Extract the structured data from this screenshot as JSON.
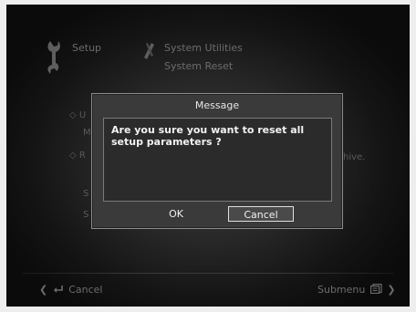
{
  "header": {
    "setup_label": "Setup",
    "utilities_label": "System Utilities",
    "subtitle": "System Reset"
  },
  "background_items": {
    "item1_frag": "U",
    "item1_line2_frag": "M",
    "item2_frag": "R",
    "item2_tail": "hive.",
    "item3_frag": "S",
    "item4_frag": "S"
  },
  "dialog": {
    "title": "Message",
    "message": "Are you sure you want to reset all setup parameters ?",
    "ok_label": "OK",
    "cancel_label": "Cancel",
    "selected": "Cancel"
  },
  "footer": {
    "back_label": "Cancel",
    "submenu_label": "Submenu"
  },
  "icons": {
    "setup": "wrench-icon",
    "utilities": "tools-icon",
    "back": "return-arrow-icon",
    "submenu": "menu-list-icon"
  },
  "colors": {
    "background": "#0b0b0b",
    "dialog": "#3a3a3a",
    "text": "#f2f2f2",
    "muted": "#6c6c6c"
  }
}
